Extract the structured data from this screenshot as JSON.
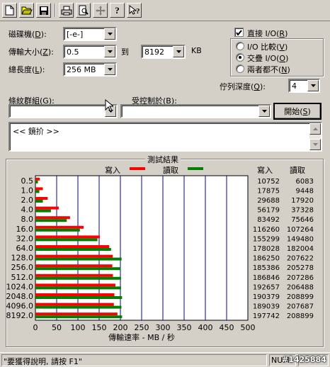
{
  "toolbar": {
    "buttons": [
      "new-document",
      "open-folder",
      "save-disk",
      "print",
      "print-preview",
      "move",
      "help",
      "context-help"
    ]
  },
  "settings": {
    "drive_label": "磁碟機",
    "drive_key": "D",
    "drive_value": "[-e-]",
    "transfer_label": "傳輸大小",
    "transfer_key": "Z",
    "transfer_from": "0.5",
    "to_label": "到",
    "transfer_to": "8192",
    "unit": "KB",
    "total_label": "總長度",
    "total_key": "L",
    "total_value": "256 MB",
    "direct_io_label": "直接 I/O",
    "direct_io_key": "R",
    "direct_io_checked": true,
    "radio_compare": "I/O 比較",
    "radio_compare_key": "V",
    "radio_overlap": "交疊 I/O",
    "radio_overlap_key": "O",
    "radio_neither": "兩者都不",
    "radio_neither_key": "N",
    "queue_label": "佇列深度",
    "queue_key": "Q",
    "queue_value": "4",
    "pattern_label": "條紋群組",
    "pattern_key": "G",
    "controlled_label": "受控制於",
    "controlled_key": "B",
    "start_button": "開始",
    "start_key": "S",
    "description_text": "<< 鏡扴 >>"
  },
  "chart_data": {
    "type": "bar",
    "title": "測試結果",
    "xlabel": "傳輸速率 - MB / 秒",
    "xlim": [
      0,
      500
    ],
    "xticks": [
      "0",
      "50",
      "100",
      "150",
      "200",
      "250",
      "300",
      "350",
      "400",
      "450",
      "500"
    ],
    "legend": [
      {
        "name": "寫入",
        "color": "#ff0000"
      },
      {
        "name": "讀取",
        "color": "#008000"
      }
    ],
    "column_headers": [
      "寫入",
      "讀取"
    ],
    "categories": [
      "0.5",
      "1.0",
      "2.0",
      "4.0",
      "8.0",
      "16.0",
      "32.0",
      "64.0",
      "128.0",
      "256.0",
      "512.0",
      "1024.0",
      "2048.0",
      "4096.0",
      "8192.0"
    ],
    "series": [
      {
        "name": "寫入",
        "color": "#ff0000",
        "values": [
          10.5,
          17.5,
          29.0,
          54.9,
          81.5,
          113.5,
          151.7,
          173.8,
          181.9,
          181.0,
          182.5,
          188.2,
          185.9,
          184.6,
          193.1
        ]
      },
      {
        "name": "讀取",
        "color": "#008000",
        "values": [
          5.9,
          9.2,
          17.5,
          36.5,
          73.8,
          104.7,
          146.0,
          178.0,
          202.8,
          200.5,
          201.5,
          201.6,
          204.0,
          202.4,
          204.0
        ]
      }
    ],
    "write_values": [
      "10752",
      "17875",
      "29688",
      "56179",
      "83492",
      "116260",
      "155299",
      "178028",
      "186250",
      "185386",
      "186846",
      "192657",
      "190379",
      "189039",
      "197742"
    ],
    "read_values": [
      "6083",
      "9448",
      "17920",
      "37328",
      "75646",
      "107264",
      "149480",
      "182004",
      "207622",
      "205278",
      "207286",
      "206488",
      "208899",
      "207687",
      "208899"
    ]
  },
  "status": {
    "help_text": "\"要獲得說明, 請按 F1\"",
    "num": "NUM",
    "watermark": "#1425884"
  }
}
